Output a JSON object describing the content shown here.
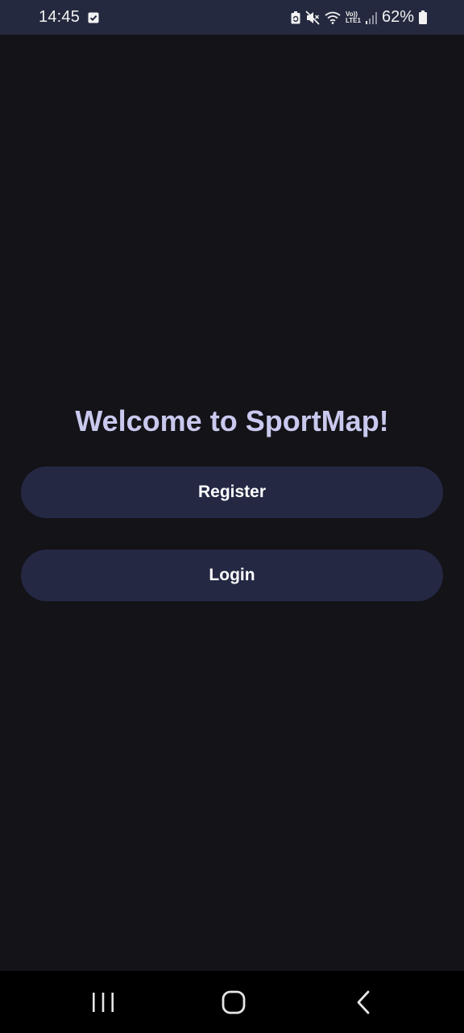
{
  "status_bar": {
    "time": "14:45",
    "battery_percent": "62%",
    "network_label_top": "Vo))",
    "network_label_bottom": "LTE1",
    "left_icons": [
      "checkbox-notification-icon"
    ],
    "right_icons": [
      "recycle-battery-icon",
      "mute-icon",
      "wifi-icon",
      "volte-lte-icon",
      "signal-icon",
      "battery-icon"
    ]
  },
  "main": {
    "title": "Welcome to SportMap!",
    "register_label": "Register",
    "login_label": "Login"
  },
  "nav_bar": {
    "icons": [
      "recents-icon",
      "home-icon",
      "back-icon"
    ]
  },
  "colors": {
    "background": "#131318",
    "status_bar": "#25293f",
    "button": "#242843",
    "title": "#c9c8ee"
  }
}
